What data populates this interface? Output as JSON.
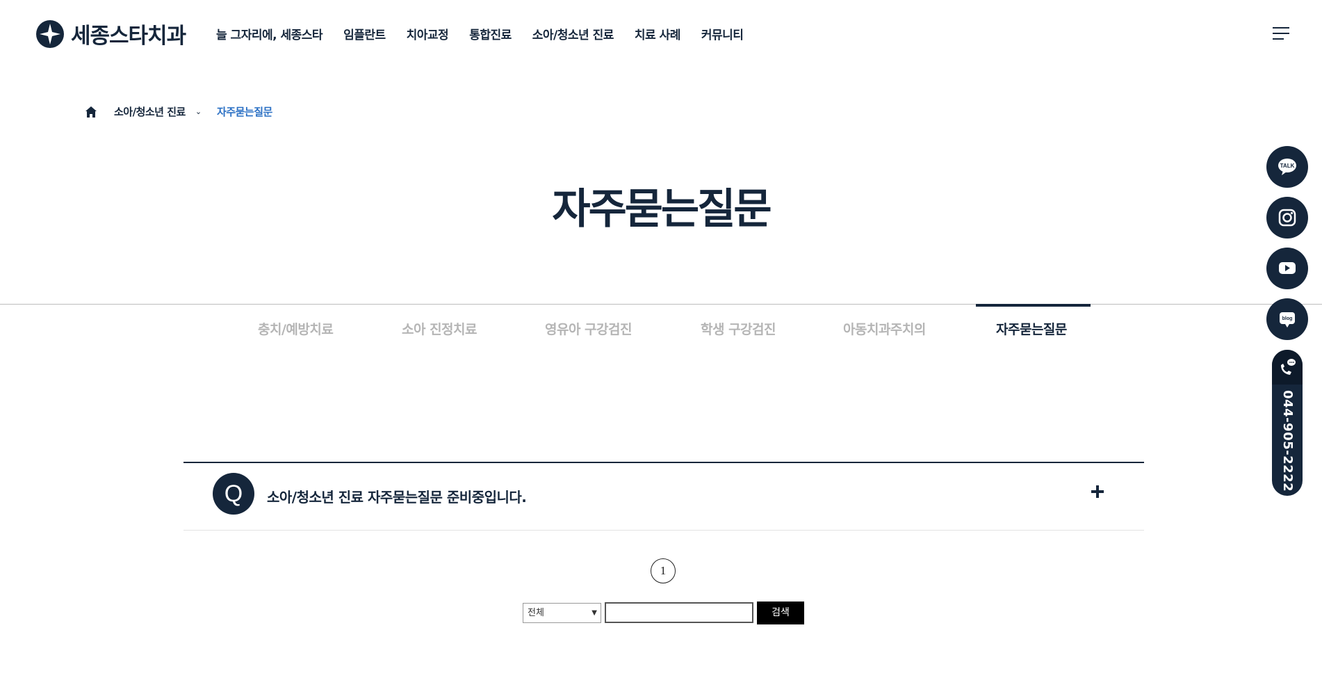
{
  "header": {
    "logo_text": "세종스타치과",
    "nav": [
      "늘 그자리에, 세종스타",
      "임플란트",
      "치아교정",
      "통합진료",
      "소아/청소년 진료",
      "치료 사례",
      "커뮤니티"
    ]
  },
  "breadcrumb": {
    "section": "소아/청소년 진료",
    "current": "자주묻는질문"
  },
  "page_title": "자주묻는질문",
  "tabs": [
    {
      "label": "충치/예방치료",
      "active": false
    },
    {
      "label": "소아 진정치료",
      "active": false
    },
    {
      "label": "영유아 구강검진",
      "active": false
    },
    {
      "label": "학생 구강검진",
      "active": false
    },
    {
      "label": "아동치과주치의",
      "active": false
    },
    {
      "label": "자주묻는질문",
      "active": true
    }
  ],
  "faq": {
    "badge": "Q",
    "items": [
      {
        "question": "소아/청소년 진료 자주묻는질문 준비중입니다."
      }
    ]
  },
  "pagination": {
    "current_page": "1"
  },
  "search": {
    "selected_option": "전체",
    "input_value": "",
    "button_label": "검색"
  },
  "floating": {
    "buttons": [
      "kakao-talk-icon",
      "instagram-icon",
      "youtube-icon",
      "blog-icon"
    ],
    "kakao_label": "TALK",
    "blog_label": "blog",
    "phone": "044-905-2222"
  },
  "colors": {
    "brand_navy": "#15263b",
    "breadcrumb_active": "#2a6fc4",
    "tab_inactive": "#b5b5b5"
  }
}
